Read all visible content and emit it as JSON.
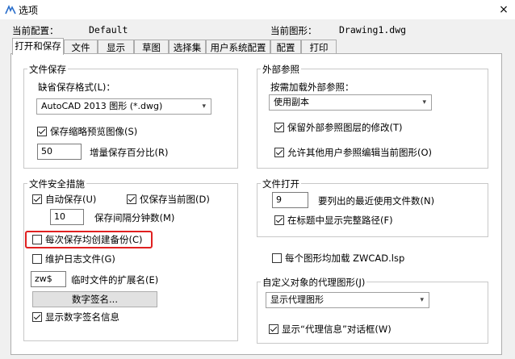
{
  "window": {
    "title": "选项",
    "close_glyph": "×"
  },
  "header": {
    "profile_label": "当前配置：",
    "profile_value": "Default",
    "drawing_label": "当前图形：",
    "drawing_value": "Drawing1.dwg"
  },
  "tabs": [
    "打开和保存",
    "文件",
    "显示",
    "草图",
    "选择集",
    "用户系统配置",
    "配置",
    "打印"
  ],
  "file_save": {
    "title": "文件保存",
    "format_label": "缺省保存格式(L)：",
    "format_value": "AutoCAD 2013 图形 (*.dwg)",
    "thumbnail": {
      "label": "保存缩略预览图像(S)",
      "checked": true
    },
    "incremental_value": "50",
    "incremental_label": "增量保存百分比(R)"
  },
  "file_safety": {
    "title": "文件安全措施",
    "autosave": {
      "label": "自动保存(U)",
      "checked": true
    },
    "save_current": {
      "label": "仅保存当前图(D)",
      "checked": true
    },
    "interval_value": "10",
    "interval_label": "保存间隔分钟数(M)",
    "backup": {
      "label": "每次保存均创建备份(C)",
      "checked": false
    },
    "log": {
      "label": "维护日志文件(G)",
      "checked": false
    },
    "temp_ext_value": "zw$",
    "temp_ext_label": "临时文件的扩展名(E)",
    "signature_button": "数字签名...",
    "signature_info": {
      "label": "显示数字签名信息",
      "checked": true
    }
  },
  "xref": {
    "title": "外部参照",
    "demand_label": "按需加载外部参照：",
    "demand_value": "使用副本",
    "retain": {
      "label": "保留外部参照图层的修改(T)",
      "checked": true
    },
    "allow_edit": {
      "label": "允许其他用户参照编辑当前图形(O)",
      "checked": true
    }
  },
  "file_open": {
    "title": "文件打开",
    "recent_value": "9",
    "recent_label": "要列出的最近使用文件数(N)",
    "full_path": {
      "label": "在标题中显示完整路径(F)",
      "checked": true
    }
  },
  "load_lsp": {
    "label": "每个图形均加载 ZWCAD.lsp",
    "checked": false
  },
  "proxy": {
    "title": "自定义对象的代理图形(J)",
    "value": "显示代理图形",
    "dialog": {
      "label": "显示“代理信息”对话框(W)",
      "checked": true
    }
  },
  "colors": {
    "highlight": "#e02020"
  }
}
